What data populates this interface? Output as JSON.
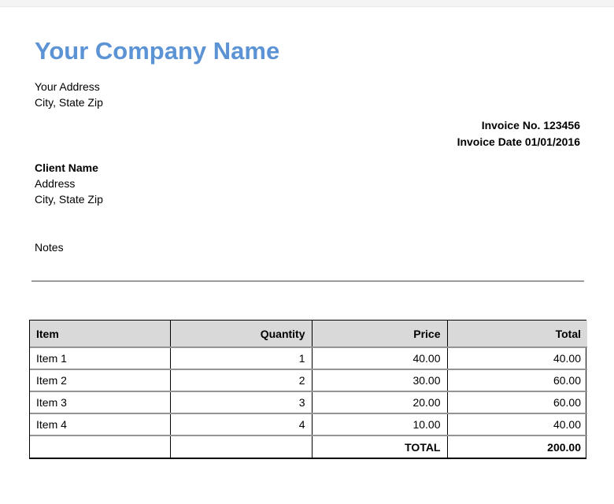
{
  "company": {
    "name": "Your Company Name",
    "address_line1": "Your Address",
    "address_line2": "City, State Zip"
  },
  "invoice_meta": {
    "invoice_no": "Invoice No. 123456",
    "invoice_date": "Invoice Date 01/01/2016"
  },
  "client": {
    "name": "Client Name",
    "address_line1": "Address",
    "address_line2": "City, State Zip"
  },
  "notes": {
    "label": "Notes"
  },
  "table": {
    "headers": [
      "Item",
      "Quantity",
      "Price",
      "Total"
    ],
    "rows": [
      {
        "item": "Item 1",
        "quantity": "1",
        "price": "40.00",
        "total": "40.00"
      },
      {
        "item": "Item 2",
        "quantity": "2",
        "price": "30.00",
        "total": "60.00"
      },
      {
        "item": "Item 3",
        "quantity": "3",
        "price": "20.00",
        "total": "60.00"
      },
      {
        "item": "Item 4",
        "quantity": "4",
        "price": "10.00",
        "total": "40.00"
      }
    ],
    "total_label": "TOTAL",
    "total_value": "200.00"
  },
  "colors": {
    "accent_blue": "#5b93d5",
    "table_header_bg": "#d9d9d9",
    "table_border_black": "#000000",
    "table_row_divider_gray": "#949494"
  }
}
